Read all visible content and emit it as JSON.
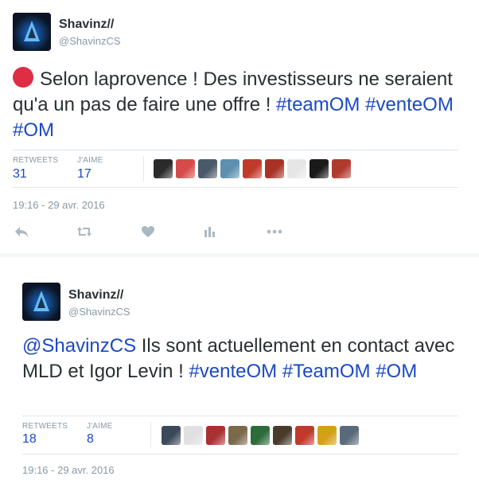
{
  "tweets": [
    {
      "author": {
        "name": "Shavinz//",
        "handle": "@ShavinzCS"
      },
      "segments": [
        {
          "text": "Selon laprovence ! Des investisseurs ne seraient qu'a un pas de faire une offre ! "
        },
        {
          "text": "#teamOM",
          "link": true
        },
        {
          "text": " "
        },
        {
          "text": "#venteOM",
          "link": true
        },
        {
          "text": " "
        },
        {
          "text": "#OM",
          "link": true
        }
      ],
      "has_red_dot": true,
      "stats": {
        "retweets_label": "RETWEETS",
        "retweets": "31",
        "likes_label": "J'AIME",
        "likes": "17"
      },
      "likers": [
        "#2b2b2b",
        "#d64a4a",
        "#4a5a6a",
        "#5c8fb0",
        "#c0392b",
        "#a93226",
        "#e6e6e6",
        "#1a1a1a",
        "#b03a2e"
      ],
      "timestamp": "19:16 - 29 avr. 2016",
      "actions": [
        "reply-icon",
        "retweet-icon",
        "like-icon",
        "analytics-icon",
        "more-icon"
      ]
    },
    {
      "author": {
        "name": "Shavinz//",
        "handle": "@ShavinzCS"
      },
      "segments": [
        {
          "text": "@ShavinzCS",
          "link": true
        },
        {
          "text": " Ils sont actuellement en contact avec MLD et Igor Levin ! "
        },
        {
          "text": "#venteOM",
          "link": true
        },
        {
          "text": " "
        },
        {
          "text": "#TeamOM",
          "link": true
        },
        {
          "text": " "
        },
        {
          "text": "#OM",
          "link": true
        }
      ],
      "has_red_dot": false,
      "stats": {
        "retweets_label": "RETWEETS",
        "retweets": "18",
        "likes_label": "J'AIME",
        "likes": "8"
      },
      "likers": [
        "#3b4a5a",
        "#e0e0e0",
        "#a83232",
        "#7a6a4a",
        "#2e6b3a",
        "#4a3a2a",
        "#c0392b",
        "#d4a017",
        "#5a6a7a"
      ],
      "timestamp": "19:16 - 29 avr. 2016"
    }
  ]
}
